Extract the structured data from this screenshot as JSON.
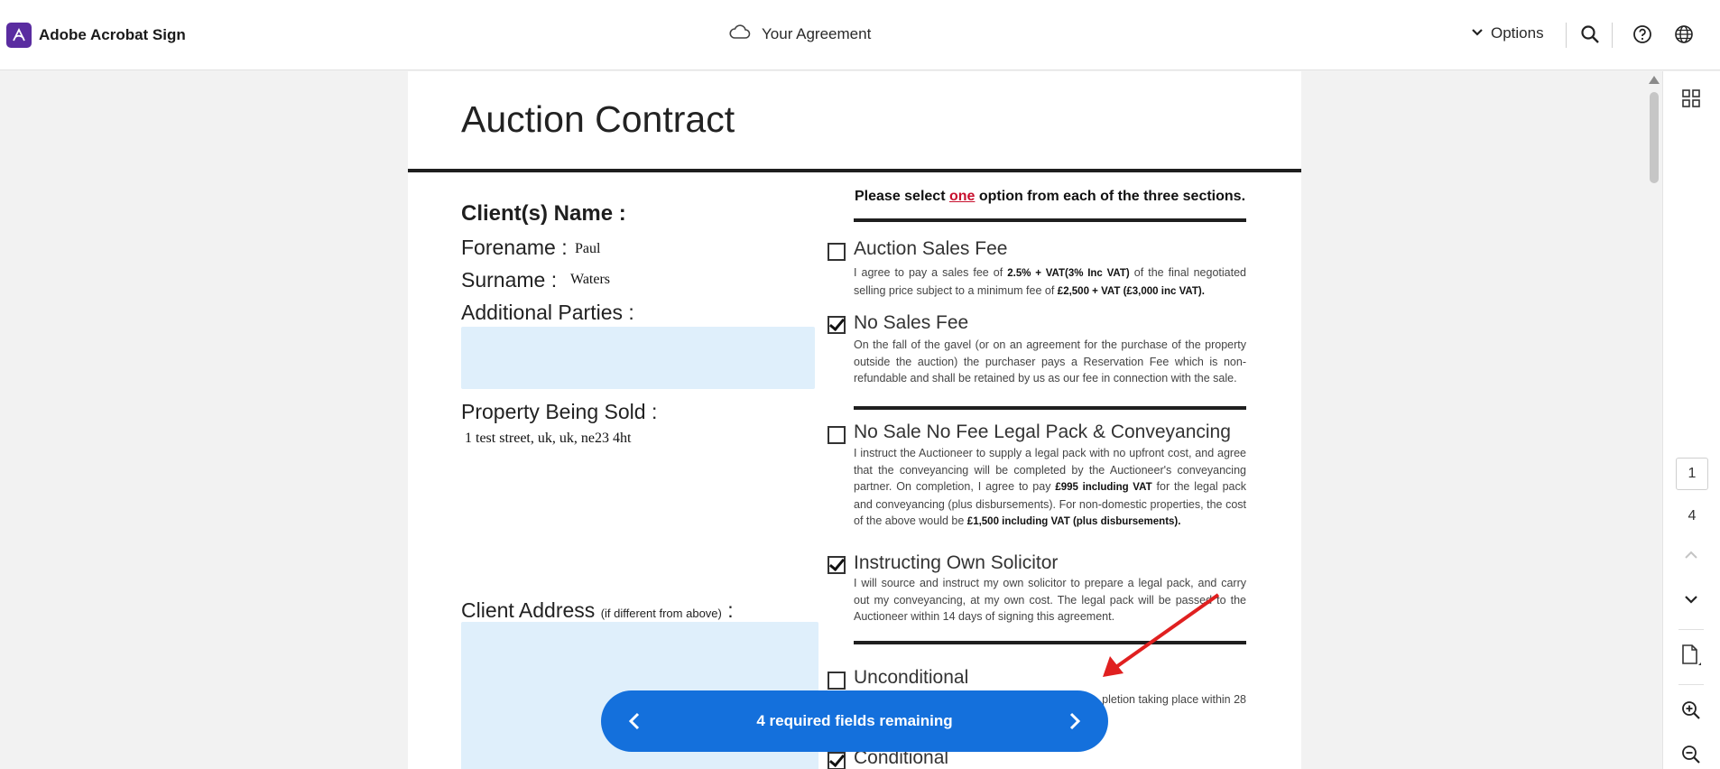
{
  "app": {
    "brand": "Adobe Acrobat Sign",
    "doc_title": "Your Agreement",
    "options_label": "Options"
  },
  "document": {
    "title": "Auction Contract",
    "client_name_label": "Client(s) Name :",
    "forename_label": "Forename :",
    "forename_value": "Paul",
    "surname_label": "Surname :",
    "surname_value": "Waters",
    "additional_parties_label": "Additional Parties :",
    "property_label": "Property Being Sold :",
    "property_value": "1 test street, uk, uk, ne23 4ht",
    "client_address_label": "Client Address",
    "client_address_note": "(if different from above)",
    "client_address_colon": ":",
    "instruction_pre": "Please select ",
    "instruction_em": "one",
    "instruction_post": " option from each of the three sections.",
    "options": [
      {
        "title": "Auction Sales Fee",
        "checked": false,
        "text_1": "I agree to pay a sales fee of ",
        "bold_1": "2.5% + VAT(3% Inc VAT)",
        "text_2": " of the final negotiated selling price subject to a minimum fee of ",
        "bold_2": "£2,500 + VAT (£3,000 inc VAT)."
      },
      {
        "title": "No Sales Fee",
        "checked": true,
        "text": "On the fall of the gavel (or on an agreement for the purchase of the property outside the auction) the purchaser pays a Reservation Fee which is non-refundable and shall be retained by us as our fee in connection with the sale."
      },
      {
        "title": "No Sale No Fee Legal Pack & Conveyancing",
        "checked": false,
        "text_1": "I instruct the Auctioneer to supply a legal pack with no upfront cost, and agree that the conveyancing will be completed by the Auctioneer's conveyancing partner. On completion, I agree to pay ",
        "bold_1": "£995 including VAT",
        "text_2": " for the legal pack and conveyancing (plus disbursements). For non-domestic properties, the cost of the above would be ",
        "bold_2": "£1,500 including VAT (plus disbursements)."
      },
      {
        "title": "Instructing Own Solicitor",
        "checked": true,
        "text": "I will source and instruct my own solicitor to prepare a legal pack, and carry out my conveyancing, at my own cost. The legal pack will be passed to the Auctioneer within 14 days of signing this agreement."
      },
      {
        "title": "Unconditional",
        "checked": false,
        "text": "...pletion taking place within 28"
      },
      {
        "title": "Conditional",
        "checked": true
      }
    ]
  },
  "required_bar": {
    "text": "4 required fields remaining"
  },
  "pager": {
    "current": "1",
    "total": "4"
  },
  "colors": {
    "brand": "#5a2ca0",
    "primary": "#1470dc",
    "field_fill": "#dfeffb",
    "accent_red": "#c8102e",
    "annotation": "#e02020"
  },
  "icons": [
    "acrobat-logo-icon",
    "cloud-icon",
    "chevron-down-icon",
    "search-icon",
    "help-icon",
    "globe-icon",
    "thumbnails-icon",
    "chevron-up-icon",
    "page-icon",
    "zoom-in-icon",
    "zoom-out-icon",
    "chevron-left-icon",
    "chevron-right-icon",
    "annotation-arrow-icon"
  ]
}
